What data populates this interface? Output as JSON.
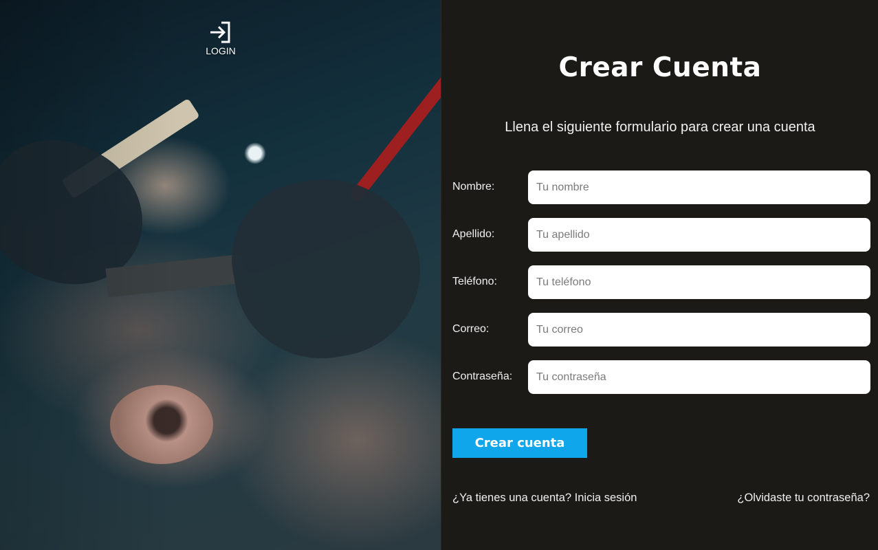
{
  "nav": {
    "login_label": "LOGIN"
  },
  "form": {
    "title": "Crear Cuenta",
    "subtitle": "Llena el siguiente formulario para crear una cuenta",
    "fields": [
      {
        "label": "Nombre:",
        "placeholder": "Tu nombre",
        "value": ""
      },
      {
        "label": "Apellido:",
        "placeholder": "Tu apellido",
        "value": ""
      },
      {
        "label": "Teléfono:",
        "placeholder": "Tu teléfono",
        "value": ""
      },
      {
        "label": "Correo:",
        "placeholder": "Tu correo",
        "value": ""
      },
      {
        "label": "Contraseña:",
        "placeholder": "Tu contraseña",
        "value": ""
      }
    ],
    "submit_label": "Crear cuenta",
    "login_prompt": "¿Ya tienes una cuenta? Inicia sesión",
    "forgot_password": "¿Olvidaste tu contraseña?"
  },
  "colors": {
    "panel_background": "#1b1a16",
    "accent": "#0fa6ec",
    "input_background": "#ffffff"
  },
  "icons": {
    "login": "login-arrow-icon"
  }
}
